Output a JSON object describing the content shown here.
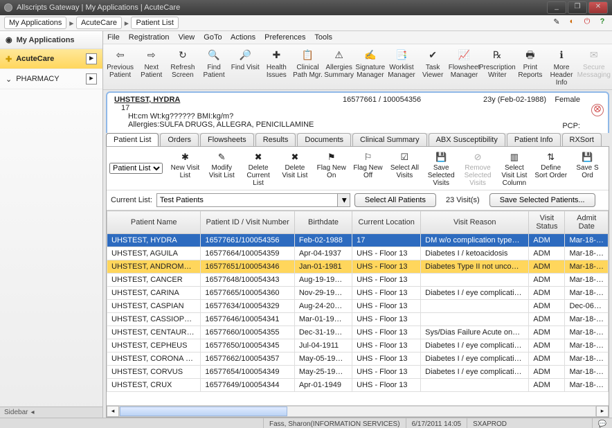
{
  "window": {
    "title": "Allscripts Gateway | My Applications | AcuteCare"
  },
  "breadcrumb": [
    "My Applications",
    "AcuteCare",
    "Patient List"
  ],
  "sidebar": {
    "header": "My Applications",
    "items": [
      {
        "label": "AcuteCare",
        "active": true
      },
      {
        "label": "PHARMACY",
        "active": false
      }
    ],
    "footer": "Sidebar"
  },
  "menu": [
    "File",
    "Registration",
    "View",
    "GoTo",
    "Actions",
    "Preferences",
    "Tools"
  ],
  "toolbar": [
    {
      "label": "Previous Patient",
      "icon": "⇦"
    },
    {
      "label": "Next Patient",
      "icon": "⇨"
    },
    {
      "label": "Refresh Screen",
      "icon": "↻"
    },
    {
      "label": "Find Patient",
      "icon": "🔍"
    },
    {
      "label": "Find Visit",
      "icon": "🔎"
    },
    {
      "label": "Health Issues",
      "icon": "✚"
    },
    {
      "label": "Clinical Path Mgr.",
      "icon": "📋"
    },
    {
      "label": "Allergies Summary",
      "icon": "⚠"
    },
    {
      "label": "Signature Manager",
      "icon": "✍"
    },
    {
      "label": "Worklist Manager",
      "icon": "📑"
    },
    {
      "label": "Task Viewer",
      "icon": "✔"
    },
    {
      "label": "Flowsheet Manager",
      "icon": "📈"
    },
    {
      "label": "Prescription Writer",
      "icon": "℞"
    },
    {
      "label": "Print Reports",
      "icon": "🖶"
    },
    {
      "label": "More Header Info",
      "icon": "ℹ"
    },
    {
      "label": "Secure Messaging",
      "icon": "✉"
    }
  ],
  "patientHeader": {
    "name": "UHSTEST, HYDRA",
    "sub1": "17",
    "vitals": "Ht:cm Wt:kg?????? BMI:kg/m?",
    "allergies": "Allergies:SULFA DRUGS, ALLEGRA, PENICILLAMINE",
    "mrn": "16577661 / 100054356",
    "ageDob": "23y (Feb-02-1988)",
    "sex": "Female",
    "pcp": "PCP:"
  },
  "tabs": [
    "Patient List",
    "Orders",
    "Flowsheets",
    "Results",
    "Documents",
    "Clinical Summary",
    "ABX Susceptibility",
    "Patient Info",
    "RXSort"
  ],
  "activeTab": "Patient List",
  "subToolbar": {
    "selector": "Patient List",
    "buttons": [
      {
        "label": "New Visit List",
        "icon": "✱"
      },
      {
        "label": "Modify Visit List",
        "icon": "✎"
      },
      {
        "label": "Delete Current List",
        "icon": "✖"
      },
      {
        "label": "Delete Visit List",
        "icon": "✖"
      },
      {
        "label": "Flag New On",
        "icon": "⚑"
      },
      {
        "label": "Flag New Off",
        "icon": "⚐"
      },
      {
        "label": "Select All Visits",
        "icon": "☑"
      },
      {
        "label": "Save Selected Visits",
        "icon": "💾"
      },
      {
        "label": "Remove Selected Visits",
        "icon": "⊘",
        "dim": true
      },
      {
        "label": "Select Visit List Column",
        "icon": "▥"
      },
      {
        "label": "Define Sort Order",
        "icon": "⇅"
      },
      {
        "label": "Save S Ord",
        "icon": "💾"
      }
    ]
  },
  "currentList": {
    "label": "Current List:",
    "value": "Test Patients",
    "selectAll": "Select All Patients",
    "count": "23 Visit(s)",
    "saveSel": "Save Selected Patients..."
  },
  "columns": [
    "Patient Name",
    "Patient ID / Visit Number",
    "Birthdate",
    "Current Location",
    "Visit Reason",
    "Visit Status",
    "Admit Date"
  ],
  "rows": [
    {
      "state": "sel",
      "c": [
        "UHSTEST, HYDRA",
        "16577661/100054356",
        "Feb-02-1988",
        "17",
        "DM w/o complication type…",
        "ADM",
        "Mar-18-…"
      ]
    },
    {
      "state": "",
      "c": [
        "UHSTEST, AGUILA",
        "16577664/100054359",
        "Apr-04-1937",
        "UHS - Floor 13",
        "Diabetes I / ketoacidosis",
        "ADM",
        "Mar-18-…"
      ]
    },
    {
      "state": "warn",
      "c": [
        "UHSTEST, ANDROMEDA",
        "16577651/100054346",
        "Jan-01-1981",
        "UHS - Floor 13",
        "Diabetes Type II not unco…",
        "ADM",
        "Mar-18-…"
      ]
    },
    {
      "state": "",
      "c": [
        "UHSTEST, CANCER",
        "16577648/100054343",
        "Aug-19-19…",
        "UHS - Floor 13",
        "",
        "ADM",
        "Mar-18-…"
      ]
    },
    {
      "state": "",
      "c": [
        "UHSTEST, CARINA",
        "16577665/100054360",
        "Nov-29-19…",
        "UHS - Floor 13",
        "Diabetes I / eye complicati…",
        "ADM",
        "Mar-18-…"
      ]
    },
    {
      "state": "",
      "c": [
        "UHSTEST, CASPIAN",
        "16577634/100054329",
        "Aug-24-20…",
        "UHS - Floor 13",
        "",
        "ADM",
        "Dec-06-…"
      ]
    },
    {
      "state": "",
      "c": [
        "UHSTEST, CASSIOPEIA",
        "16577646/100054341",
        "Mar-01-19…",
        "UHS - Floor 13",
        "",
        "ADM",
        "Mar-18-…"
      ]
    },
    {
      "state": "",
      "c": [
        "UHSTEST, CENTAURUS",
        "16577660/100054355",
        "Dec-31-19…",
        "UHS - Floor 13",
        "Sys/Dias Failure Acute on…",
        "ADM",
        "Mar-18-…"
      ]
    },
    {
      "state": "",
      "c": [
        "UHSTEST, CEPHEUS",
        "16577650/100054345",
        "Jul-04-1911",
        "UHS - Floor 13",
        "Diabetes I / eye complicati…",
        "ADM",
        "Mar-18-…"
      ]
    },
    {
      "state": "",
      "c": [
        "UHSTEST, CORONA BO…",
        "16577662/100054357",
        "May-05-19…",
        "UHS - Floor 13",
        "Diabetes I / eye complicati…",
        "ADM",
        "Mar-18-…"
      ]
    },
    {
      "state": "",
      "c": [
        "UHSTEST, CORVUS",
        "16577654/100054349",
        "May-25-19…",
        "UHS - Floor 13",
        "Diabetes I / eye complicati…",
        "ADM",
        "Mar-18-…"
      ]
    },
    {
      "state": "",
      "c": [
        "UHSTEST, CRUX",
        "16577649/100054344",
        "Apr-01-1949",
        "UHS - Floor 13",
        "",
        "ADM",
        "Mar-18-…"
      ]
    }
  ],
  "statusbar": {
    "user": "Fass, Sharon(INFORMATION SERVICES)",
    "datetime": "6/17/2011 14:05",
    "env": "SXAPROD"
  }
}
